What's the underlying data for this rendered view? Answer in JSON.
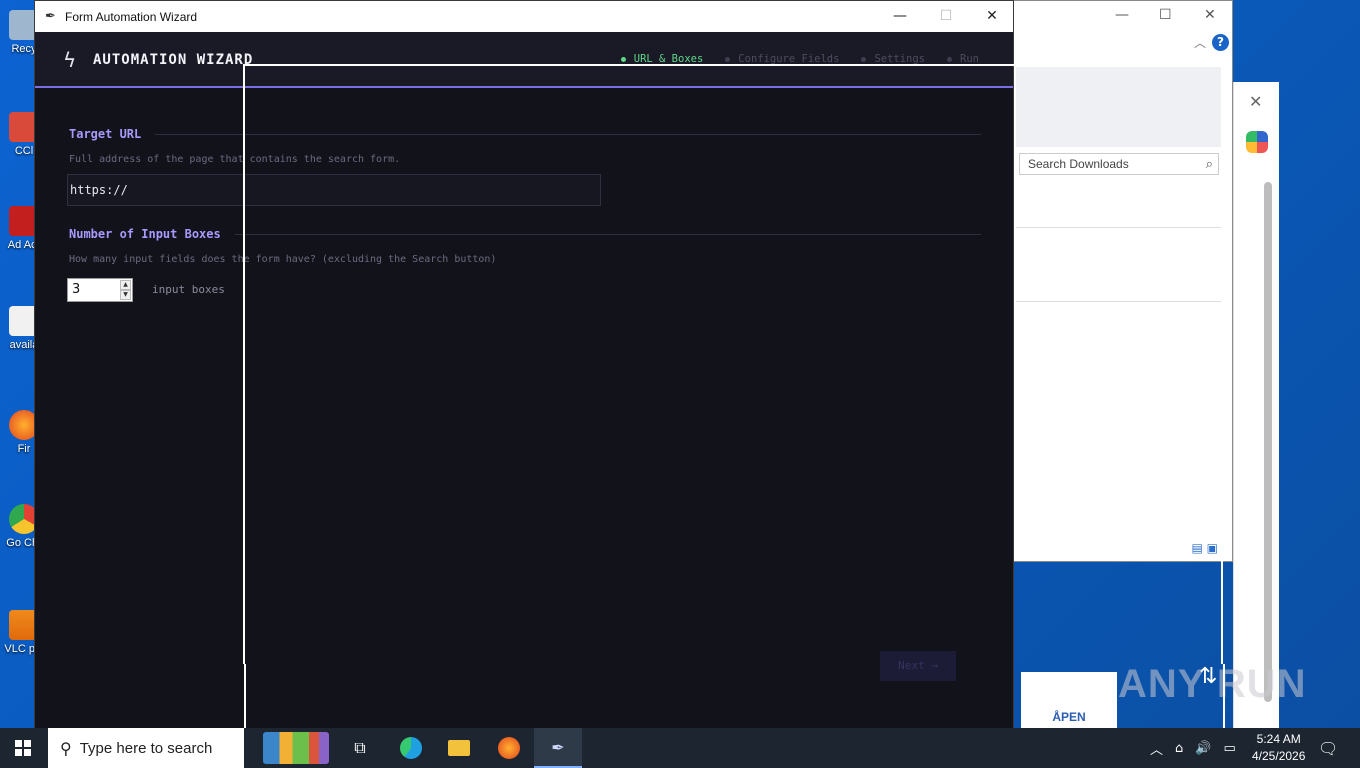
{
  "desktop": {
    "icons": [
      {
        "label": "Recy"
      },
      {
        "label": "CCl"
      },
      {
        "label": "Ad Acr"
      },
      {
        "label": "availa"
      },
      {
        "label": "Fir"
      },
      {
        "label": "Go Chr"
      },
      {
        "label": "VLC pla"
      }
    ]
  },
  "background_window": {
    "search_placeholder": "Search Downloads",
    "help_label": "?",
    "open_label": "ÅPEN"
  },
  "app": {
    "window_title": "Form Automation Wizard",
    "brand": "AUTOMATION WIZARD",
    "steps": [
      {
        "label": "URL & Boxes",
        "active": true
      },
      {
        "label": "Configure Fields",
        "active": false
      },
      {
        "label": "Settings",
        "active": false
      },
      {
        "label": "Run",
        "active": false
      }
    ],
    "url_section": {
      "title": "Target URL",
      "hint": "Full address of the page that contains the search form.",
      "value": "https://"
    },
    "boxes_section": {
      "title": "Number of Input Boxes",
      "hint": "How many input fields does the form have? (excluding the Search button)",
      "value": "3",
      "unit": "input boxes"
    },
    "next_label": "Next →"
  },
  "watermark": "ANY RUN",
  "taskbar": {
    "search_placeholder": "Type here to search",
    "time": "5:24 AM",
    "date": "4/25/2026"
  },
  "colors": {
    "accent": "#7b6ee0",
    "section_title": "#a899ff",
    "active_step": "#5fd68a",
    "app_bg": "#12121a"
  }
}
